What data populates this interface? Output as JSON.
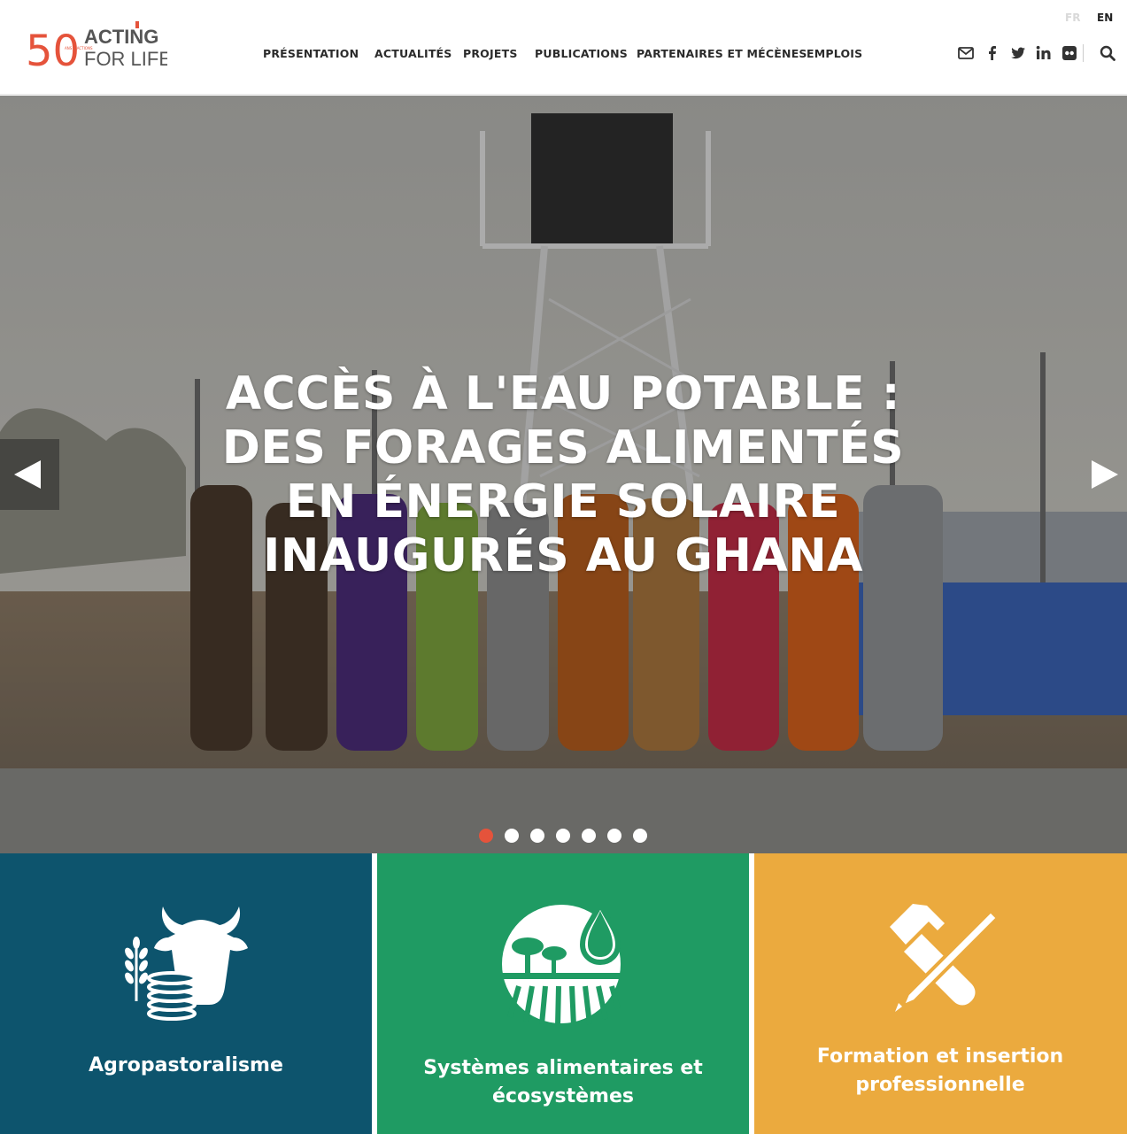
{
  "brand": {
    "logo_number": "50",
    "logo_small_text": "ANS D'ACTIONS",
    "logo_word1": "ACTING",
    "logo_word2": "FOR LIFE",
    "logo_accent_color": "#e5533b",
    "logo_text_color": "#555555"
  },
  "language": {
    "fr": "FR",
    "en": "EN"
  },
  "nav": {
    "items": [
      {
        "label": "PRÉSENTATION"
      },
      {
        "label": "ACTUALITÉS"
      },
      {
        "label": "PROJETS"
      },
      {
        "label": "PUBLICATIONS"
      },
      {
        "label": "PARTENAIRES ET MÉCÈNES"
      },
      {
        "label": "EMPLOIS"
      }
    ]
  },
  "social": {
    "icons": [
      "mail-icon",
      "facebook-icon",
      "twitter-icon",
      "linkedin-icon",
      "flickr-icon",
      "search-icon"
    ]
  },
  "hero": {
    "title": "ACCÈS À L'EAU POTABLE : DES FORAGES ALIMENTÉS EN ÉNERGIE SOLAIRE INAUGURÉS AU GHANA",
    "slide_count": 7,
    "active_slide": 1,
    "active_dot_color": "#e5533b"
  },
  "tiles": [
    {
      "label": "Agropastoralisme",
      "color": "#0d546d",
      "icon": "livestock-coins-icon"
    },
    {
      "label": "Systèmes alimentaires et écosystèmes",
      "color": "#1f9b63",
      "icon": "ecosystem-water-icon"
    },
    {
      "label": "Formation et insertion professionnelle",
      "color": "#ebaa3e",
      "icon": "hammer-pencil-icon"
    }
  ]
}
